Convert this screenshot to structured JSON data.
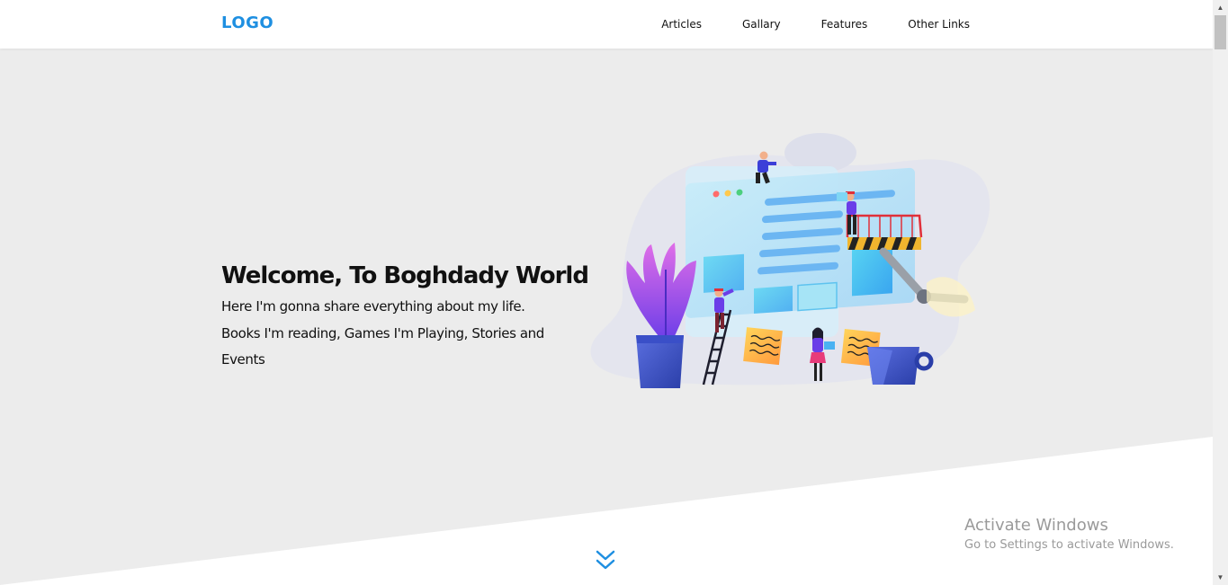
{
  "header": {
    "logo": "LOGO",
    "nav": [
      {
        "label": "Articles"
      },
      {
        "label": "Gallary"
      },
      {
        "label": "Features"
      },
      {
        "label": "Other Links"
      }
    ]
  },
  "hero": {
    "title": "Welcome, To Boghdady World",
    "description": "Here I'm gonna share everything about my life. Books I'm reading, Games I'm Playing, Stories and Events"
  },
  "watermark": {
    "line1": "Activate Windows",
    "line2": "Go to Settings to activate Windows."
  },
  "colors": {
    "accent": "#1e8fe1",
    "background": "#ececec"
  },
  "icons": {
    "scroll_down": "double-chevron-down-icon",
    "scroll_up": "triangle-up-icon",
    "scroll_down_arrow": "triangle-down-icon"
  }
}
